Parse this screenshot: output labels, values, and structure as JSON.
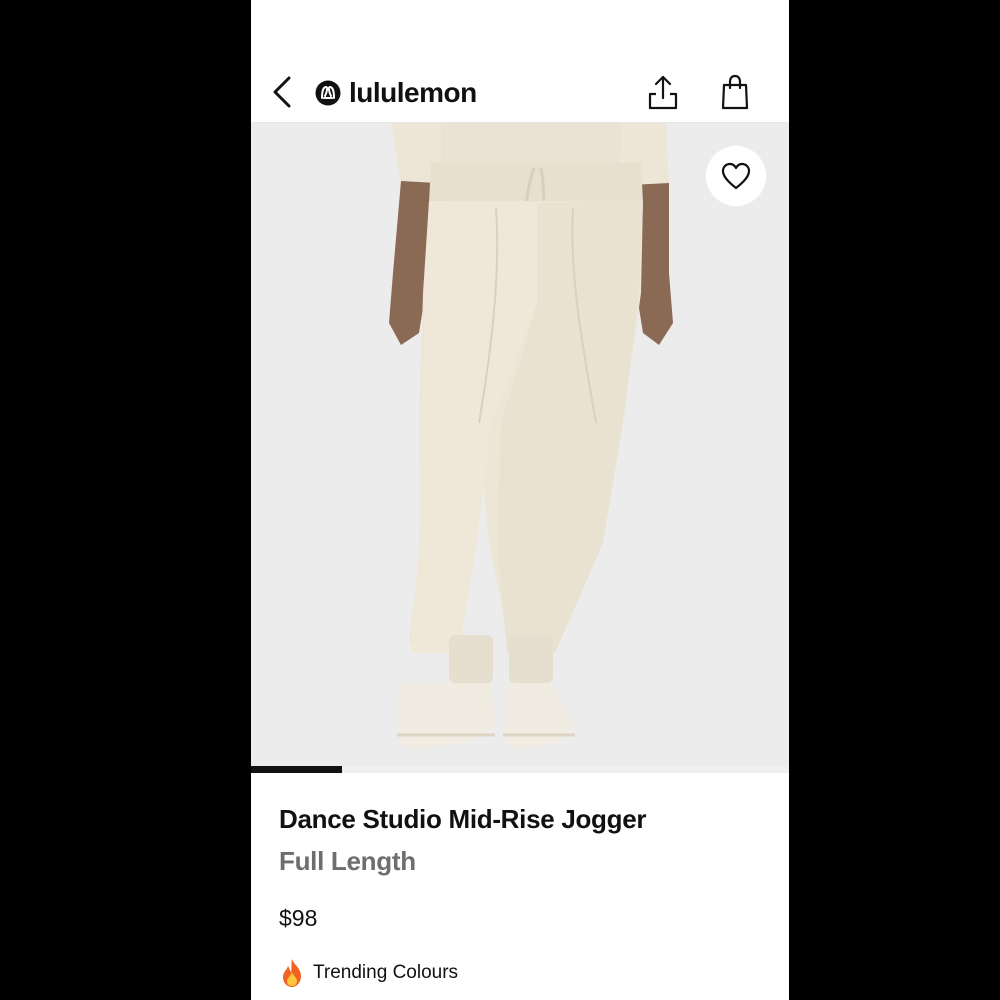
{
  "header": {
    "brand_name": "lululemon",
    "back_icon": "chevron-left-icon",
    "share_icon": "share-icon",
    "bag_icon": "shopping-bag-icon"
  },
  "gallery": {
    "wishlist_icon": "heart-outline-icon",
    "image_progress": 0.17
  },
  "product": {
    "name": "Dance Studio Mid-Rise Jogger",
    "subtitle": "Full Length",
    "price": "$98",
    "trending_label": "Trending Colours",
    "trending_icon": "fire-icon"
  },
  "colors": {
    "background": "#000000",
    "page": "#ffffff",
    "text_primary": "#111111",
    "text_secondary": "#6e6e6e",
    "image_bg": "#ececec",
    "garment": "#ede6d6"
  }
}
